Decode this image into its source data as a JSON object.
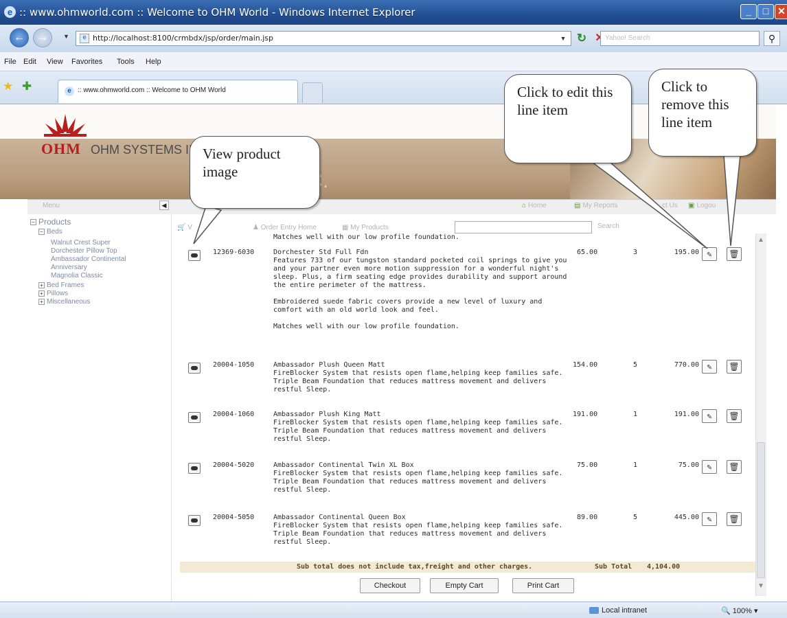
{
  "window": {
    "title": ":: www.ohmworld.com :: Welcome to OHM World - Windows Internet Explorer",
    "url": "http://localhost:8100/crmbdx/jsp/order/main.jsp",
    "search_placeholder": "Yahoo! Search",
    "menu": [
      "File",
      "Edit",
      "View",
      "Favorites",
      "Tools",
      "Help"
    ],
    "tab_title": ":: www.ohmworld.com :: Welcome to OHM World",
    "status_zone": "Local intranet",
    "zoom": "100%"
  },
  "header": {
    "logo_text": "OHM",
    "company_name": "OHM SYSTEMS INC",
    "banner_ghost": "IC.",
    "menu_label": "Menu",
    "top_links": [
      "Home",
      "My Reports",
      "ct Us",
      "Logou"
    ]
  },
  "sidebar": {
    "root": "Products",
    "beds": "Beds",
    "bed_items": [
      "Walnut Crest Super",
      "Dorchester Pillow Top",
      "Ambassador Continental",
      "Anniversary",
      "Magnolia Classic"
    ],
    "other_groups": [
      "Bed Frames",
      "Pillows",
      "Miscellaneous"
    ]
  },
  "toolbar": {
    "cart_label": "V",
    "order_entry": "Order Entry Home",
    "my_products": "My Products",
    "search_label": "Search"
  },
  "cart": {
    "top_fragment": "Matches well with our low profile foundation.",
    "rows": [
      {
        "sku": "12369-6030",
        "name": "Dorchester Std Full Fdn",
        "desc": [
          "Features 733 of our tungston standard pocketed coil springs to give you and your partner even more motion suppression for a wonderful night's sleep. Plus, a firm seating edge provides durability and support around the entire perimeter of the mattress.",
          "",
          "Embroidered suede fabric covers provide a new level of luxury and comfort with an old world look and feel.",
          "",
          "Matches well with our low profile foundation."
        ],
        "price": "65.00",
        "qty": "3",
        "total": "195.00"
      },
      {
        "sku": "20004-1050",
        "name": "Ambassador Plush Queen Matt",
        "desc": [
          "FireBlocker System that resists open flame,helping keep families safe.",
          "Triple Beam Foundation that reduces mattress movement and delivers restful Sleep."
        ],
        "price": "154.00",
        "qty": "5",
        "total": "770.00"
      },
      {
        "sku": "20004-1060",
        "name": "Ambassador Plush King Matt",
        "desc": [
          "FireBlocker System that resists open flame,helping keep families safe.",
          "Triple Beam Foundation that reduces mattress movement and delivers restful Sleep."
        ],
        "price": "191.00",
        "qty": "1",
        "total": "191.00"
      },
      {
        "sku": "20004-5020",
        "name": "Ambassador Continental Twin XL Box",
        "desc": [
          "FireBlocker System that resists open flame,helping keep families safe.",
          "Triple Beam Foundation that reduces mattress movement and delivers restful Sleep."
        ],
        "price": "75.00",
        "qty": "1",
        "total": "75.00"
      },
      {
        "sku": "20004-5050",
        "name": "Ambassador Continental Queen Box",
        "desc": [
          "FireBlocker System that resists open flame,helping keep families safe.",
          "Triple Beam Foundation that reduces mattress movement and delivers restful Sleep."
        ],
        "price": "89.00",
        "qty": "5",
        "total": "445.00"
      }
    ],
    "subtotal_note": "Sub total does not include tax,freight and other charges.",
    "subtotal_label": "Sub Total",
    "subtotal_value": "4,104.00",
    "buttons": [
      "Checkout",
      "Empty Cart",
      "Print Cart"
    ]
  },
  "callouts": {
    "view_image": "View product image",
    "edit": "Click to edit this line item",
    "remove": "Click to remove this line item"
  },
  "icons": {
    "edit": "pencil-icon",
    "remove": "trash-icon",
    "image": "camera-icon"
  }
}
